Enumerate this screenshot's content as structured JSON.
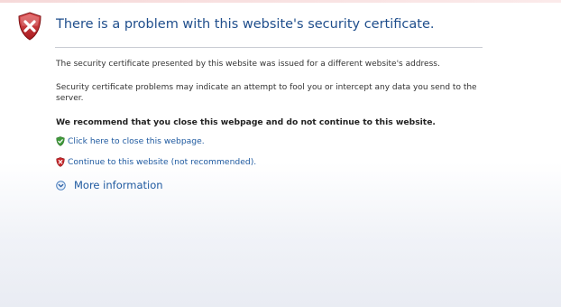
{
  "error": {
    "title": "There is a problem with this website's security certificate.",
    "paragraph1": "The security certificate presented by this website was issued for a different website's address.",
    "paragraph2": "Security certificate problems may indicate an attempt to fool you or intercept any data you send to the server.",
    "recommendation": "We recommend that you close this webpage and do not continue to this website."
  },
  "actions": {
    "close_label": "Click here to close this webpage.",
    "continue_label": "Continue to this website (not recommended).",
    "more_info_label": "More information"
  },
  "colors": {
    "title": "#1f4e8c",
    "link": "#1f5aa0",
    "error_red": "#c8282c",
    "safe_green": "#3f9a3a"
  },
  "icons": {
    "header": "error-shield-icon",
    "close": "green-shield-icon",
    "continue": "red-shield-icon",
    "more": "expand-circle-icon"
  }
}
